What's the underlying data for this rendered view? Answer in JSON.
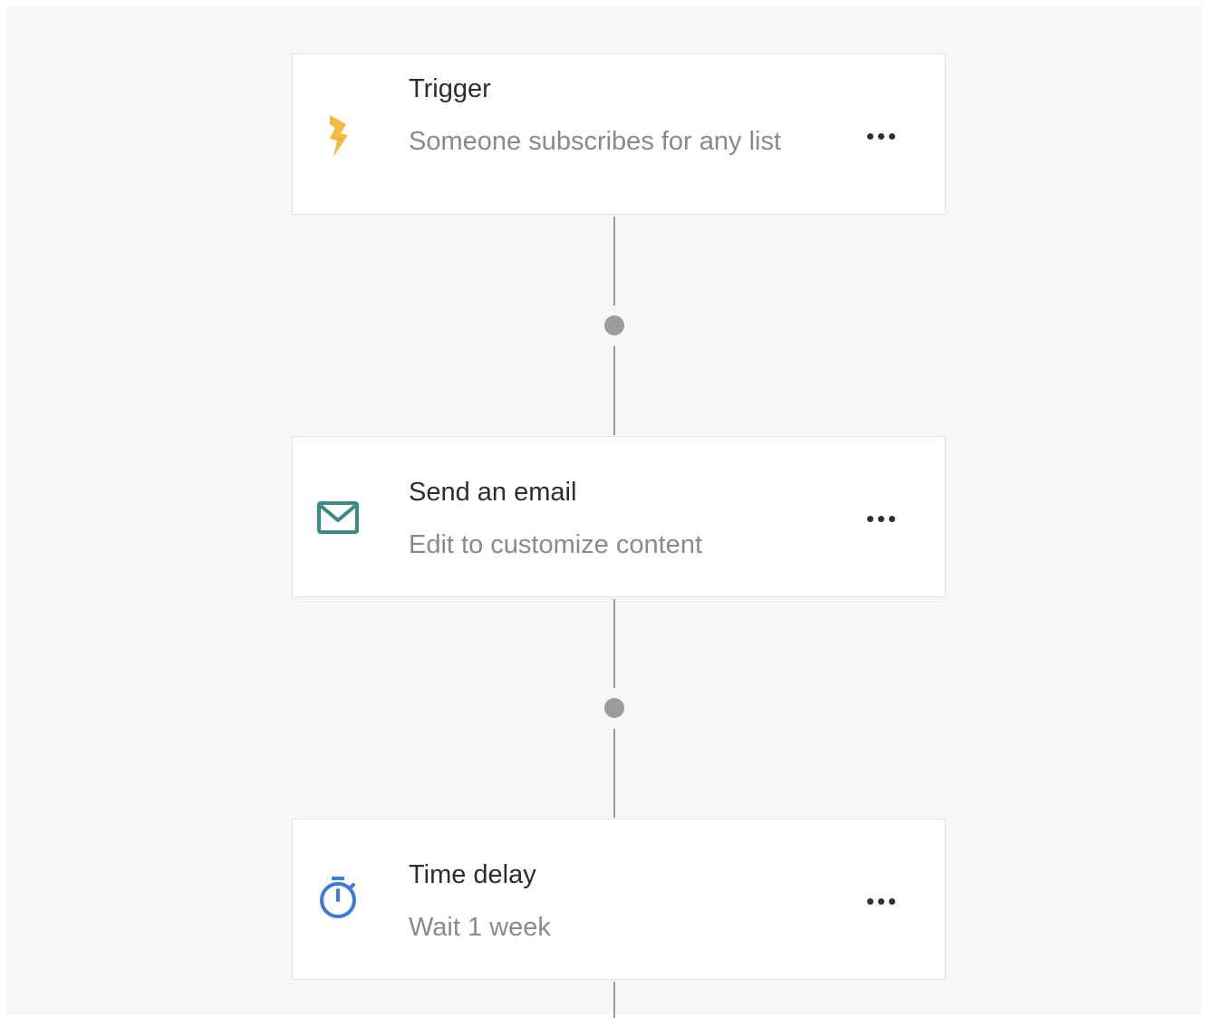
{
  "workflow": {
    "steps": [
      {
        "title": "Trigger",
        "description": "Someone subscribes for any list",
        "icon": "lightning-icon",
        "icon_color": "#f5b942"
      },
      {
        "title": "Send an email",
        "description": "Edit to customize content",
        "icon": "envelope-icon",
        "icon_color": "#3a8a85"
      },
      {
        "title": "Time delay",
        "description": "Wait 1 week",
        "icon": "stopwatch-icon",
        "icon_color": "#3b7ad9"
      }
    ],
    "more_icon": "ellipsis-icon",
    "connector_color": "#9a9a9a"
  }
}
